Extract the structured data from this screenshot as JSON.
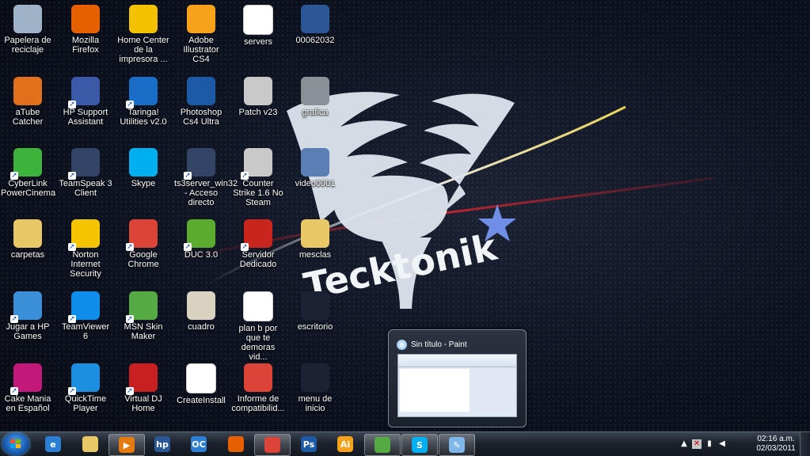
{
  "desktop": {
    "icons": [
      {
        "label": "Papelera de reciclaje",
        "icon": "recycle-bin-icon",
        "color": "#9fb3c8"
      },
      {
        "label": "Mozilla Firefox",
        "icon": "firefox-icon",
        "color": "#e66000"
      },
      {
        "label": "Home Center de la impresora ...",
        "icon": "printer-home-center-icon",
        "color": "#f2c200"
      },
      {
        "label": "Adobe Illustrator CS4",
        "icon": "illustrator-icon",
        "color": "#f7a21b"
      },
      {
        "label": "servers",
        "icon": "text-file-icon",
        "color": "#ffffff"
      },
      {
        "label": "00062032",
        "icon": "word-document-icon",
        "color": "#2b5797"
      },
      {
        "label": "aTube Catcher",
        "icon": "atube-catcher-icon",
        "color": "#e0701c"
      },
      {
        "label": "HP Support Assistant",
        "icon": "hp-support-icon",
        "color": "#3a5aa8"
      },
      {
        "label": "Taringa! Utilities v2.0",
        "icon": "taringa-icon",
        "color": "#1a6ec8"
      },
      {
        "label": "Photoshop Cs4 Ultra",
        "icon": "photoshop-icon",
        "color": "#1d5aa6"
      },
      {
        "label": "Patch v23",
        "icon": "counter-strike-icon",
        "color": "#c9c9c9"
      },
      {
        "label": "grafica",
        "icon": "image-file-icon",
        "color": "#8a9096"
      },
      {
        "label": "CyberLink PowerCinema",
        "icon": "powercinema-icon",
        "color": "#3cb43c"
      },
      {
        "label": "TeamSpeak 3 Client",
        "icon": "teamspeak-icon",
        "color": "#334466"
      },
      {
        "label": "Skype",
        "icon": "skype-icon",
        "color": "#00aff0"
      },
      {
        "label": "ts3server_win32 - Acceso directo",
        "icon": "teamspeak-server-icon",
        "color": "#334466"
      },
      {
        "label": "Counter Strike 1.6 No Steam",
        "icon": "counter-strike-icon",
        "color": "#c9c9c9"
      },
      {
        "label": "video0001",
        "icon": "video-file-icon",
        "color": "#5b7fb5"
      },
      {
        "label": "carpetas",
        "icon": "folder-icon",
        "color": "#e8c766"
      },
      {
        "label": "Norton Internet Security",
        "icon": "norton-icon",
        "color": "#f5c400"
      },
      {
        "label": "Google Chrome",
        "icon": "chrome-icon",
        "color": "#db4437"
      },
      {
        "label": "DUC 3.0",
        "icon": "duc-icon",
        "color": "#5aab2e"
      },
      {
        "label": "Servidor Dedicado",
        "icon": "server-icon",
        "color": "#c8261d"
      },
      {
        "label": "mesclas",
        "icon": "folder-icon",
        "color": "#e8c766"
      },
      {
        "label": "Jugar a HP Games",
        "icon": "hp-games-icon",
        "color": "#3a8fd8"
      },
      {
        "label": "TeamViewer 6",
        "icon": "teamviewer-icon",
        "color": "#0e8ee9"
      },
      {
        "label": "MSN Skin Maker",
        "icon": "msn-icon",
        "color": "#55aa44"
      },
      {
        "label": "cuadro",
        "icon": "image-file-icon",
        "color": "#d9d2c0"
      },
      {
        "label": "plan b   por que te demoras vid...",
        "icon": "mp3-file-icon",
        "color": "#ffffff"
      },
      {
        "label": "escritorio",
        "icon": "image-file-icon",
        "color": "#1a2233"
      },
      {
        "label": "Cake Mania en Español",
        "icon": "cake-mania-icon",
        "color": "#c2187a"
      },
      {
        "label": "QuickTime Player",
        "icon": "quicktime-icon",
        "color": "#1c8fe0"
      },
      {
        "label": "Virtual DJ Home",
        "icon": "virtual-dj-icon",
        "color": "#c82020"
      },
      {
        "label": "CreateInstall",
        "icon": "generic-file-icon",
        "color": "#ffffff"
      },
      {
        "label": "Informe de compatibilid...",
        "icon": "chrome-icon",
        "color": "#db4437"
      },
      {
        "label": "menu de inicio",
        "icon": "image-file-icon",
        "color": "#1a2233"
      }
    ]
  },
  "wallpaper": {
    "text": "Tecktonik"
  },
  "preview": {
    "title": "Sin título - Paint"
  },
  "taskbar": {
    "items": [
      {
        "name": "internet-explorer",
        "icon": "ie-icon",
        "glyph": "e",
        "color": "#2a7fd4",
        "active": false
      },
      {
        "name": "explorer",
        "icon": "folder-icon",
        "glyph": "",
        "color": "#e8c766",
        "active": false
      },
      {
        "name": "media-player",
        "icon": "media-player-icon",
        "glyph": "▶",
        "color": "#e57a10",
        "active": true
      },
      {
        "name": "hp",
        "icon": "hp-icon",
        "glyph": "hp",
        "color": "#2b5797",
        "active": false
      },
      {
        "name": "ooVoo",
        "icon": "oovoo-icon",
        "glyph": "OC",
        "color": "#2b7fd4",
        "active": false
      },
      {
        "name": "firefox",
        "icon": "firefox-icon",
        "glyph": "",
        "color": "#e66000",
        "active": false
      },
      {
        "name": "chrome",
        "icon": "chrome-icon",
        "glyph": "",
        "color": "#db4437",
        "active": true
      },
      {
        "name": "photoshop",
        "icon": "photoshop-icon",
        "glyph": "Ps",
        "color": "#1d5aa6",
        "active": false
      },
      {
        "name": "illustrator",
        "icon": "illustrator-icon",
        "glyph": "Ai",
        "color": "#f7a21b",
        "active": false
      },
      {
        "name": "msn",
        "icon": "msn-icon",
        "glyph": "",
        "color": "#55aa44",
        "active": true
      },
      {
        "name": "skype",
        "icon": "skype-icon",
        "glyph": "S",
        "color": "#00aff0",
        "active": true
      },
      {
        "name": "paint",
        "icon": "paint-icon",
        "glyph": "✎",
        "color": "#7fb8e8",
        "active": true
      }
    ],
    "tray": {
      "time": "02:16 a.m.",
      "date": "02/03/2011"
    }
  }
}
